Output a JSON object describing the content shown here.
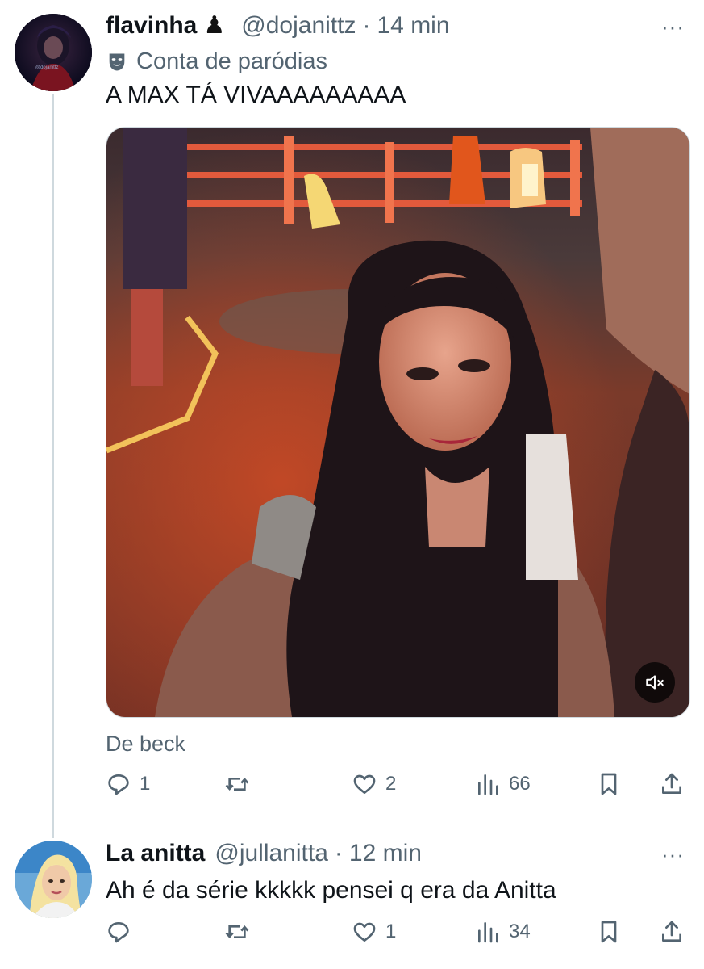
{
  "tweet1": {
    "display_name": "flavinha",
    "name_emoji": "♟",
    "handle": "@dojanittz",
    "separator": "·",
    "time": "14 min",
    "more": "···",
    "parody_label": "Conta de paródias",
    "text": "A MAX TÁ VIVAAAAAAAAA",
    "caption": "De beck",
    "avatar_text": "@dojanittz",
    "actions": {
      "replies": "1",
      "reposts": "",
      "likes": "2",
      "views": "66"
    }
  },
  "tweet2": {
    "display_name": "La anitta",
    "handle": "@jullanitta",
    "separator": "·",
    "time": "12 min",
    "more": "···",
    "text": "Ah é da série kkkkk pensei q era da Anitta",
    "actions": {
      "replies": "",
      "reposts": "",
      "likes": "1",
      "views": "34"
    }
  },
  "icons": {
    "reply": "reply-icon",
    "repost": "repost-icon",
    "like": "heart-icon",
    "views": "views-icon",
    "bookmark": "bookmark-icon",
    "share": "share-icon",
    "mute": "muted-speaker-icon",
    "parody": "theater-mask-icon"
  },
  "colors": {
    "text": "#0f1419",
    "secondary": "#536471",
    "line": "#cfd9de"
  }
}
